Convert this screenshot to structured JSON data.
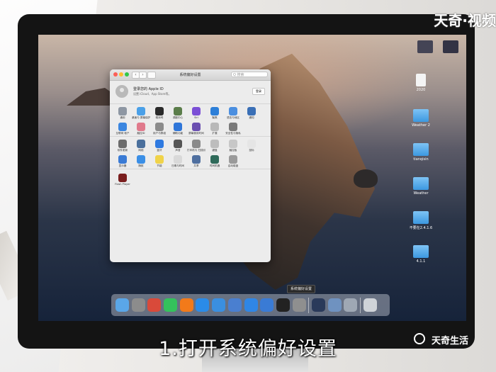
{
  "window": {
    "title": "系统偏好设置",
    "search_placeholder": "Q 搜索",
    "nav_back": "‹",
    "nav_forward": "›"
  },
  "account": {
    "title": "登录您的 Apple ID",
    "subtitle": "设置 iCloud、App Store等。",
    "login_label": "登录"
  },
  "prefs_row1": [
    {
      "label": "通用",
      "color": "#8e97a3",
      "icon": "general-icon"
    },
    {
      "label": "桌面与\n屏幕保护程序",
      "color": "#4aa0e8",
      "icon": "desktop-icon"
    },
    {
      "label": "程序坞",
      "color": "#2a2a2a",
      "icon": "dock-icon"
    },
    {
      "label": "调度中心",
      "color": "#5b7d4a",
      "icon": "mission-control-icon"
    },
    {
      "label": "Siri",
      "color": "#7b4fd6",
      "icon": "siri-icon"
    },
    {
      "label": "聚焦",
      "color": "#2d7fd8",
      "icon": "spotlight-icon"
    },
    {
      "label": "语言与地区",
      "color": "#4b8fe0",
      "icon": "language-icon"
    },
    {
      "label": "通知",
      "color": "#3a6fb6",
      "icon": "notifications-icon"
    }
  ],
  "prefs_row2": [
    {
      "label": "互联网\n帐户",
      "color": "#3b86e0",
      "icon": "internet-accounts-icon"
    },
    {
      "label": "触控ID",
      "color": "#e07a8c",
      "icon": "touch-id-icon"
    },
    {
      "label": "用户与群组",
      "color": "#8b8b8b",
      "icon": "users-icon"
    },
    {
      "label": "辅助功能",
      "color": "#2f76d9",
      "icon": "accessibility-icon"
    },
    {
      "label": "屏幕使用时间",
      "color": "#6a4fb0",
      "icon": "screen-time-icon"
    },
    {
      "label": "扩展",
      "color": "#b8b8b8",
      "icon": "extensions-icon"
    },
    {
      "label": "安全性与隐私",
      "color": "#7a7a7a",
      "icon": "security-icon"
    }
  ],
  "prefs_row3": [
    {
      "label": "软件更新",
      "color": "#6b6b6b",
      "icon": "software-update-icon"
    },
    {
      "label": "网络",
      "color": "#4a6f9c",
      "icon": "network-icon"
    },
    {
      "label": "蓝牙",
      "color": "#2f7ae0",
      "icon": "bluetooth-icon"
    },
    {
      "label": "声音",
      "color": "#555555",
      "icon": "sound-icon"
    },
    {
      "label": "打印机与\n扫描仪",
      "color": "#8a8a8a",
      "icon": "printers-icon"
    },
    {
      "label": "键盘",
      "color": "#bdbdbd",
      "icon": "keyboard-icon"
    },
    {
      "label": "触控板",
      "color": "#c7c7c7",
      "icon": "trackpad-icon"
    },
    {
      "label": "鼠标",
      "color": "#e5e5e5",
      "icon": "mouse-icon"
    }
  ],
  "prefs_row4": [
    {
      "label": "显示器",
      "color": "#3a7bd5",
      "icon": "displays-icon"
    },
    {
      "label": "随航",
      "color": "#3b8fe6",
      "icon": "sidecar-icon"
    },
    {
      "label": "节能",
      "color": "#f0d34a",
      "icon": "energy-saver-icon"
    },
    {
      "label": "日期与时间",
      "color": "#d9d9d9",
      "icon": "date-time-icon"
    },
    {
      "label": "共享",
      "color": "#4f6f9f",
      "icon": "sharing-icon"
    },
    {
      "label": "时间机器",
      "color": "#2f6a5a",
      "icon": "time-machine-icon"
    },
    {
      "label": "启动磁盘",
      "color": "#9a9a9a",
      "icon": "startup-disk-icon"
    }
  ],
  "prefs_other": {
    "label": "Flash Player",
    "color": "#7a1e1e",
    "icon": "flash-player-icon"
  },
  "desktop": {
    "items": [
      "",
      "",
      "2020",
      "Weather 2",
      "tianqisin",
      "Weather",
      "不要在2.4.1.6",
      "4.1.1"
    ]
  },
  "dock": {
    "tooltip": "系统偏好设置",
    "apps": [
      {
        "name": "finder",
        "color": "#5aa6e8"
      },
      {
        "name": "launchpad",
        "color": "#8c8c8c"
      },
      {
        "name": "safari-alt",
        "color": "#d94a3a"
      },
      {
        "name": "wechat",
        "color": "#34c25c"
      },
      {
        "name": "firefox",
        "color": "#f27a1a"
      },
      {
        "name": "safari",
        "color": "#2a8be8"
      },
      {
        "name": "xcode",
        "color": "#3a8fe0"
      },
      {
        "name": "files",
        "color": "#4a7fd0"
      },
      {
        "name": "app-store",
        "color": "#2f86e6"
      },
      {
        "name": "uploader",
        "color": "#3a7bd5"
      },
      {
        "name": "terminal",
        "color": "#222222"
      },
      {
        "name": "system-preferences",
        "color": "#8f8f8f"
      },
      {
        "name": "quicktime",
        "color": "#2a3a5a"
      },
      {
        "name": "preview",
        "color": "#6f92c0"
      },
      {
        "name": "utility",
        "color": "#9fa8b4"
      },
      {
        "name": "trash",
        "color": "#cfd3d8"
      }
    ]
  },
  "overlay": {
    "caption": "1.打开系统偏好设置",
    "watermark_top": "天奇·视频",
    "watermark_bottom": "天奇生活"
  }
}
